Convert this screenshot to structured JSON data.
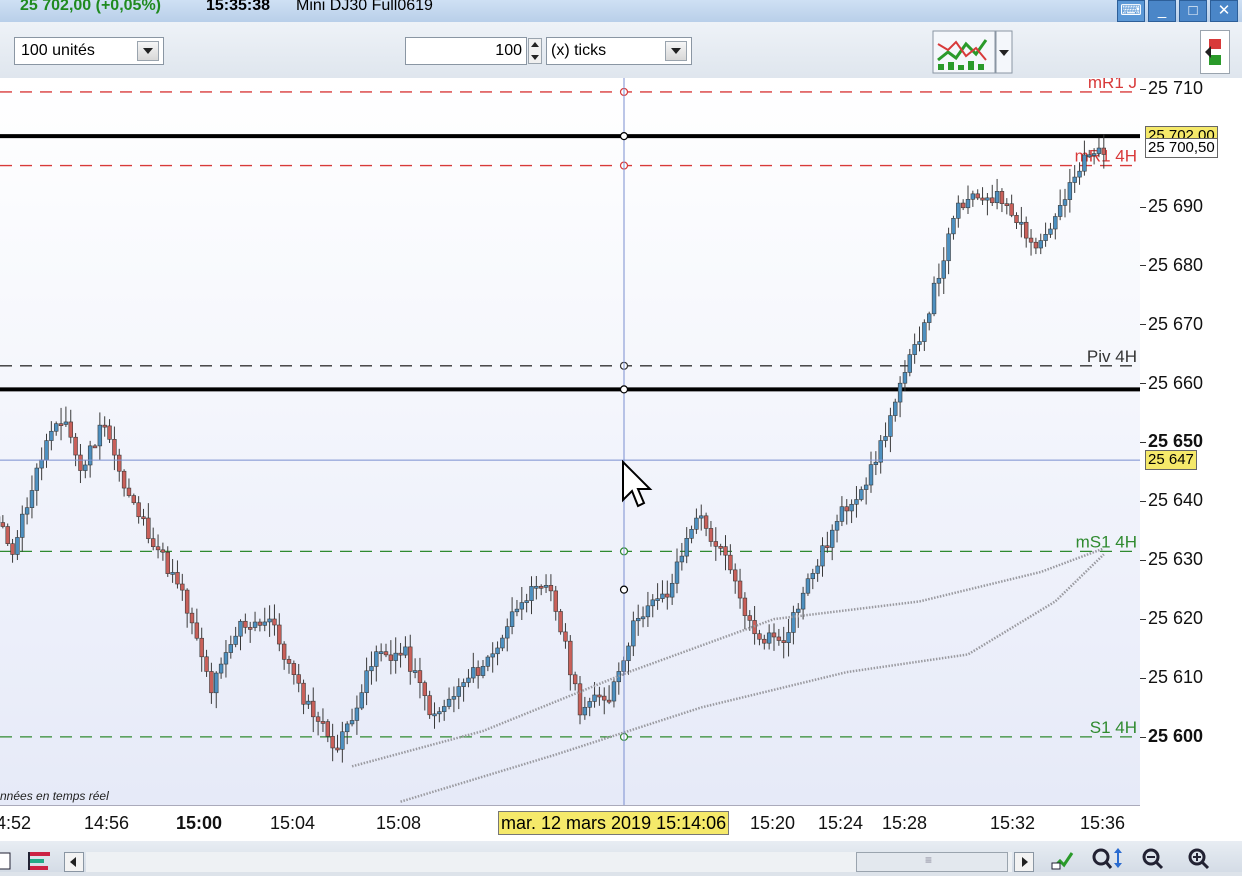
{
  "window": {
    "price_change": "25 702,00 (+0,05%)",
    "time": "15:35:38",
    "instrument": "Mini DJ30 Full0619",
    "buttons": [
      "keyboard-icon",
      "minimize-icon",
      "restore-icon",
      "close-icon"
    ]
  },
  "toolbar": {
    "units_select": "100 unités",
    "ticks_value": "100",
    "ticks_select": "(x) ticks",
    "indicator_icon": "indicator-chart-icon",
    "right_icon": "chart-style-icon"
  },
  "chart_data": {
    "type": "candlestick",
    "instrument": "Mini DJ30 Full0619",
    "x_ticks": [
      "4:52",
      "14:56",
      "15:00",
      "15:04",
      "15:08",
      "15:20",
      "15:24",
      "15:28",
      "15:32",
      "15:36"
    ],
    "x_major_tick": "15:00",
    "crosshair_label": "mar. 12 mars 2019 15:14:06",
    "y_ticks": [
      25710,
      25690,
      25680,
      25670,
      25660,
      25650,
      25640,
      25630,
      25620,
      25610,
      25600
    ],
    "y_tick_labels": [
      "25 710",
      "25 690",
      "25 680",
      "25 670",
      "25 660",
      "25 650",
      "25 640",
      "25 630",
      "25 620",
      "25 610",
      "25 600"
    ],
    "y_bold_ticks": [
      "25 650",
      "25 600"
    ],
    "ylim": [
      25592,
      25715
    ],
    "last_price": {
      "value": 25702.0,
      "label": "25 702,00"
    },
    "bid_price": {
      "value": 25700.5,
      "label": "25 700,50"
    },
    "crosshair_price": {
      "value": 25647,
      "label": "25 647"
    },
    "levels": [
      {
        "name": "mR1 J",
        "value": 25709.5,
        "color": "#d83a3a",
        "style": "dashed"
      },
      {
        "name": "mR1 4H",
        "value": 25697,
        "color": "#d83a3a",
        "style": "dashed"
      },
      {
        "name": "Piv 4H",
        "value": 25663,
        "color": "#333333",
        "style": "dashed"
      },
      {
        "name": "mS1 4H",
        "value": 25631.5,
        "color": "#2f8a2f",
        "style": "dashed"
      },
      {
        "name": "S1 4H",
        "value": 25600,
        "color": "#2f8a2f",
        "style": "dashed"
      }
    ],
    "horizontal_lines": [
      25702,
      25659
    ],
    "anchors": [
      {
        "t": 0,
        "p": 25636
      },
      {
        "t": 3,
        "p": 25632
      },
      {
        "t": 10,
        "p": 25650
      },
      {
        "t": 14,
        "p": 25654
      },
      {
        "t": 17,
        "p": 25645
      },
      {
        "t": 22,
        "p": 25654
      },
      {
        "t": 26,
        "p": 25642
      },
      {
        "t": 33,
        "p": 25632
      },
      {
        "t": 38,
        "p": 25624
      },
      {
        "t": 44,
        "p": 25608
      },
      {
        "t": 50,
        "p": 25619
      },
      {
        "t": 56,
        "p": 25620
      },
      {
        "t": 62,
        "p": 25608
      },
      {
        "t": 70,
        "p": 25598
      },
      {
        "t": 78,
        "p": 25614
      },
      {
        "t": 84,
        "p": 25614
      },
      {
        "t": 90,
        "p": 25603
      },
      {
        "t": 96,
        "p": 25609
      },
      {
        "t": 102,
        "p": 25614
      },
      {
        "t": 108,
        "p": 25624
      },
      {
        "t": 114,
        "p": 25625
      },
      {
        "t": 120,
        "p": 25605
      },
      {
        "t": 126,
        "p": 25607
      },
      {
        "t": 132,
        "p": 25621
      },
      {
        "t": 138,
        "p": 25624
      },
      {
        "t": 144,
        "p": 25638
      },
      {
        "t": 150,
        "p": 25630
      },
      {
        "t": 156,
        "p": 25617
      },
      {
        "t": 162,
        "p": 25617
      },
      {
        "t": 168,
        "p": 25628
      },
      {
        "t": 174,
        "p": 25638
      },
      {
        "t": 180,
        "p": 25645
      },
      {
        "t": 186,
        "p": 25659
      },
      {
        "t": 192,
        "p": 25673
      },
      {
        "t": 198,
        "p": 25690
      },
      {
        "t": 204,
        "p": 25692
      },
      {
        "t": 208,
        "p": 25691
      },
      {
        "t": 214,
        "p": 25683
      },
      {
        "t": 218,
        "p": 25688
      },
      {
        "t": 224,
        "p": 25698
      },
      {
        "t": 228,
        "p": 25700
      }
    ],
    "moving_averages": [
      {
        "name": "ma-fast",
        "points": [
          [
            73,
            25595
          ],
          [
            100,
            25601
          ],
          [
            130,
            25611
          ],
          [
            160,
            25620
          ],
          [
            190,
            25623
          ],
          [
            215,
            25628
          ],
          [
            228,
            25632
          ]
        ]
      },
      {
        "name": "ma-slow",
        "points": [
          [
            83,
            25589
          ],
          [
            115,
            25597
          ],
          [
            145,
            25605
          ],
          [
            175,
            25611
          ],
          [
            200,
            25614
          ],
          [
            218,
            25623
          ],
          [
            228,
            25631
          ]
        ]
      }
    ],
    "up_color": "#4d90c0",
    "down_color": "#c9605a",
    "note": "nnées en temps réel"
  },
  "bottom": {
    "scroll_grip": "≡",
    "icons": [
      "draw-tool-icon",
      "zoom-y-icon",
      "zoom-out-icon",
      "zoom-in-icon"
    ]
  }
}
